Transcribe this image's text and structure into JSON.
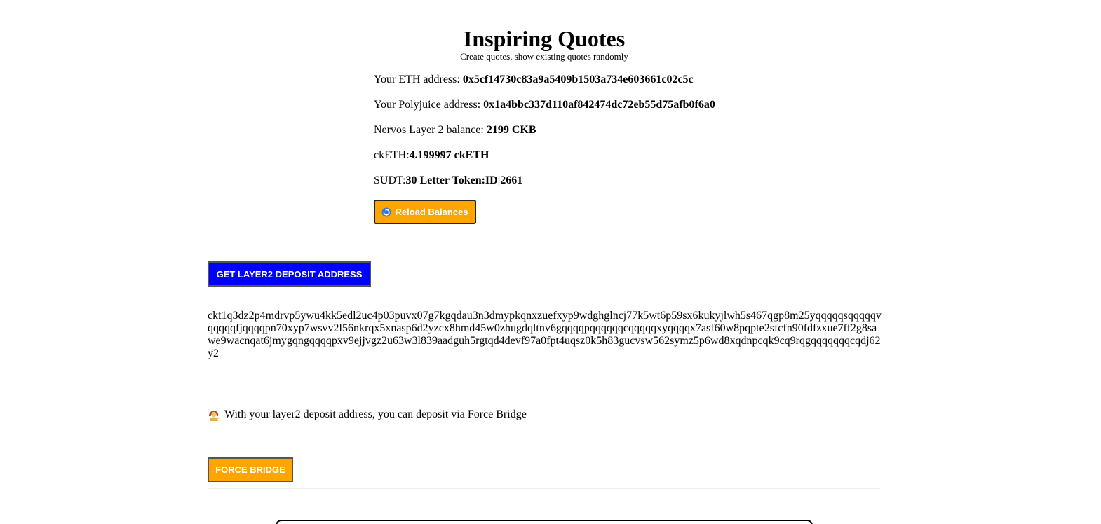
{
  "header": {
    "title": "Inspiring Quotes",
    "subtitle": "Create quotes, show existing quotes randomly"
  },
  "account": {
    "eth_label": "Your ETH address: ",
    "eth_value": "0x5cf14730c83a9a5409b1503a734e603661c02c5c",
    "polyjuice_label": "Your Polyjuice address: ",
    "polyjuice_value": "0x1a4bbc337d110af842474dc72eb55d75afb0f6a0",
    "l2_balance_label": "Nervos Layer 2 balance: ",
    "l2_balance_value": "2199 CKB",
    "cketh_label": "ckETH:",
    "cketh_value": "4.199997 ckETH",
    "sudt_label": "SUDT:",
    "sudt_value": "30 Letter Token:ID|2661"
  },
  "reload_button": {
    "label": "Reload Balances",
    "icon": "reload-icon"
  },
  "deposit": {
    "button_label": "GET LAYER2 DEPOSIT ADDRESS",
    "address": "ckt1q3dz2p4mdrvp5ywu4kk5edl2uc4p03puvx07g7kgqdau3n3dmypkqnxzuefxyp9wdghglncj77k5wt6p59sx6kukyjlwh5s467qgp8m25yqqqqqsqqqqqvqqqqqfjqqqqpn70xyp7wsvv2l56nkrqx5xnasp6d2yzcx8hmd45w0zhugdqltnv6gqqqqpqqqqqqcqqqqqxyqqqqx7asf60w8pqpte2sfcfn90fdfzxue7ff2g8sawe9wacnqat6jmygqngqqqqpxv9ejjvgz2u63w3l839aadguh5rgtqd4devf97a0fpt4uqsz0k5h83gucvsw562symz5p6wd8xqdnpcqk9cq9rqgqqqqqqqcqdj62y2",
    "note_icon": "person-tipping-hand-icon",
    "note": "With your layer2 deposit address, you can deposit via Force Bridge",
    "force_bridge_label": "FORCE BRIDGE"
  },
  "colors": {
    "orange": "#ffa500",
    "blue": "#0000ff"
  }
}
